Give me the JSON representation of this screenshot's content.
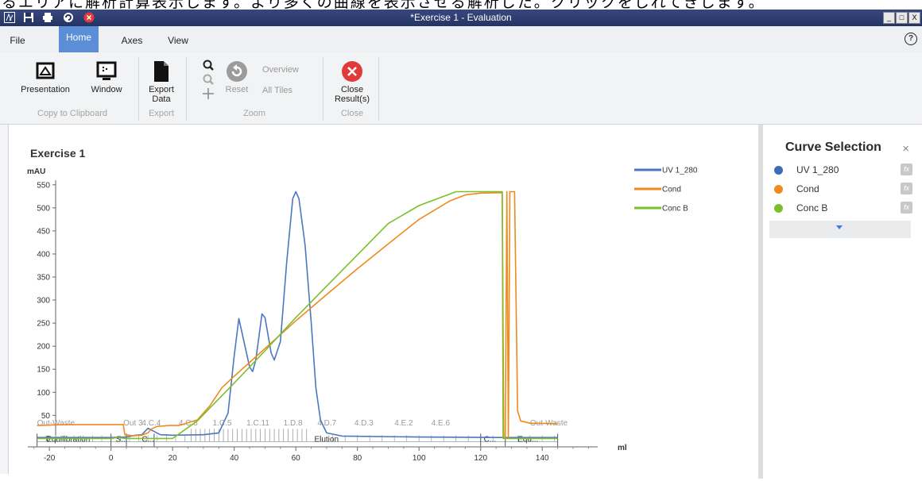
{
  "top_text": "るエリアに解析計算表示します。より多くの曲線を表示させる解析した。クリックをしれてきします。",
  "window": {
    "title": "*Exercise 1 - Evaluation",
    "controls": [
      "_",
      "□",
      "X"
    ]
  },
  "menu": {
    "items": [
      "File",
      "Home",
      "Axes",
      "View"
    ],
    "active": "Home",
    "help": "?"
  },
  "ribbon": {
    "presentation": "Presentation",
    "window": "Window",
    "export_line1": "Export",
    "export_line2": "Data",
    "reset": "Reset",
    "overview": "Overview",
    "all_tiles": "All Tiles",
    "close_line1": "Close",
    "close_line2": "Result(s)",
    "groups": {
      "copy": "Copy to Clipboard",
      "export": "Export",
      "zoom": "Zoom",
      "close": "Close"
    }
  },
  "curve_panel": {
    "title": "Curve Selection",
    "close": "×",
    "fx": "fx",
    "curves": [
      {
        "name": "UV 1_280",
        "color": "#3b6cb5"
      },
      {
        "name": "Cond",
        "color": "#ef8a1e"
      },
      {
        "name": "Conc B",
        "color": "#7bbf2a"
      }
    ]
  },
  "colors": {
    "uv": "#4a78be",
    "cond": "#ef8a1e",
    "concb": "#7bbf2a",
    "accent": "#5b8ed6",
    "close_red": "#e03a3a"
  },
  "chart_data": {
    "type": "line",
    "title": "Exercise 1",
    "ylabel": "mAU",
    "xlabel": "ml",
    "xlim": [
      -27,
      158
    ],
    "ylim": [
      -8,
      560
    ],
    "xticks": [
      -20,
      0,
      20,
      40,
      60,
      80,
      100,
      120,
      140
    ],
    "yticks": [
      0,
      50,
      100,
      150,
      200,
      250,
      300,
      350,
      400,
      450,
      500,
      550
    ],
    "legend": "top-right",
    "grid": false,
    "series": [
      {
        "name": "UV 1_280",
        "color": "#4a78be",
        "points": [
          [
            -24,
            2
          ],
          [
            0,
            2
          ],
          [
            5,
            3
          ],
          [
            8,
            7
          ],
          [
            10,
            8
          ],
          [
            12,
            22
          ],
          [
            14,
            15
          ],
          [
            16,
            8
          ],
          [
            20,
            7
          ],
          [
            30,
            8
          ],
          [
            35,
            12
          ],
          [
            38,
            55
          ],
          [
            40,
            180
          ],
          [
            41.5,
            260
          ],
          [
            43,
            215
          ],
          [
            45,
            155
          ],
          [
            46,
            145
          ],
          [
            47,
            170
          ],
          [
            49,
            270
          ],
          [
            50,
            262
          ],
          [
            52,
            185
          ],
          [
            53,
            170
          ],
          [
            55,
            210
          ],
          [
            57,
            380
          ],
          [
            59,
            520
          ],
          [
            60,
            535
          ],
          [
            61,
            520
          ],
          [
            63,
            420
          ],
          [
            65,
            250
          ],
          [
            66.5,
            110
          ],
          [
            68,
            40
          ],
          [
            70,
            12
          ],
          [
            75,
            5
          ],
          [
            100,
            3
          ],
          [
            126,
            2
          ],
          [
            130,
            2
          ],
          [
            145,
            2
          ]
        ]
      },
      {
        "name": "Cond",
        "color": "#ef8a1e",
        "points": [
          [
            -24,
            28
          ],
          [
            -15,
            30
          ],
          [
            0,
            30
          ],
          [
            4,
            30
          ],
          [
            4.5,
            8
          ],
          [
            7,
            6
          ],
          [
            10,
            7
          ],
          [
            12,
            12
          ],
          [
            13,
            20
          ],
          [
            15,
            26
          ],
          [
            19,
            28
          ],
          [
            22,
            28
          ],
          [
            28,
            40
          ],
          [
            32,
            70
          ],
          [
            36,
            110
          ],
          [
            40,
            135
          ],
          [
            50,
            195
          ],
          [
            60,
            255
          ],
          [
            70,
            312
          ],
          [
            80,
            368
          ],
          [
            90,
            422
          ],
          [
            100,
            475
          ],
          [
            110,
            515
          ],
          [
            115,
            528
          ],
          [
            120,
            532
          ],
          [
            127,
            533
          ],
          [
            127.5,
            2
          ],
          [
            128,
            2
          ],
          [
            128.5,
            535
          ],
          [
            129,
            2
          ],
          [
            129.5,
            535
          ],
          [
            131,
            535
          ],
          [
            132,
            60
          ],
          [
            133,
            38
          ],
          [
            136,
            33
          ],
          [
            145,
            32
          ]
        ]
      },
      {
        "name": "Conc B",
        "color": "#7bbf2a",
        "points": [
          [
            -24,
            0
          ],
          [
            0,
            0
          ],
          [
            2,
            2
          ],
          [
            5,
            0
          ],
          [
            14,
            0
          ],
          [
            20,
            0
          ],
          [
            28,
            38
          ],
          [
            40,
            120
          ],
          [
            50,
            190
          ],
          [
            60,
            262
          ],
          [
            70,
            330
          ],
          [
            80,
            398
          ],
          [
            90,
            466
          ],
          [
            100,
            505
          ],
          [
            112,
            535
          ],
          [
            120,
            535
          ],
          [
            127,
            535
          ],
          [
            127.3,
            0
          ],
          [
            145,
            0
          ]
        ]
      }
    ],
    "fraction_labels": [
      {
        "x": -24,
        "text": "Out-Waste"
      },
      {
        "x": 4,
        "text": "Out 3"
      },
      {
        "x": 10,
        "text": "4.C.4"
      },
      {
        "x": 22,
        "text": "4.C.8"
      },
      {
        "x": 33,
        "text": "1.C.5"
      },
      {
        "x": 44,
        "text": "1.C.11"
      },
      {
        "x": 56,
        "text": "1.D.8"
      },
      {
        "x": 67,
        "text": "4.D.7"
      },
      {
        "x": 79,
        "text": "4.D.3"
      },
      {
        "x": 92,
        "text": "4.E.2"
      },
      {
        "x": 104,
        "text": "4.E.6"
      },
      {
        "x": 136,
        "text": "Out-Waste"
      }
    ],
    "phase_labels": [
      {
        "x": -21,
        "text": "Equilibration"
      },
      {
        "x": 1.5,
        "text": "S..."
      },
      {
        "x": 10,
        "text": "C..."
      },
      {
        "x": 66,
        "text": "Elution"
      },
      {
        "x": 121,
        "text": "C..."
      },
      {
        "x": 132,
        "text": "Equ..."
      }
    ]
  }
}
